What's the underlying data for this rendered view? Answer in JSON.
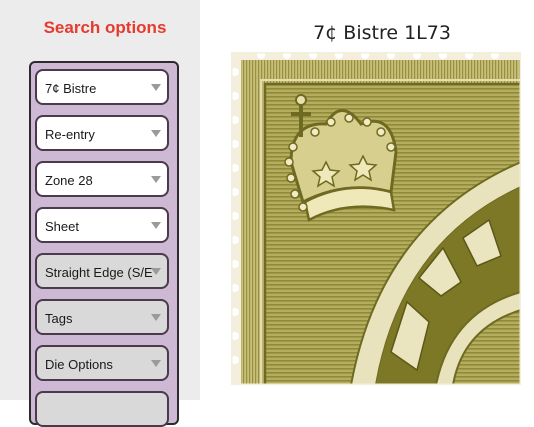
{
  "sidebar": {
    "title": "Search options",
    "dropdowns": [
      {
        "label": "7¢ Bistre"
      },
      {
        "label": "Re-entry"
      },
      {
        "label": "Zone 28"
      },
      {
        "label": "Sheet"
      },
      {
        "label": "Straight Edge (S/E)"
      },
      {
        "label": "Tags"
      },
      {
        "label": "Die Options"
      },
      {
        "label": ""
      }
    ]
  },
  "main": {
    "title": "7¢ Bistre 1L73",
    "image_icon": "stamp-closeup-image"
  },
  "colors": {
    "accent": "#e63b2e",
    "panel": "#cdb9d3",
    "stamp_ink": "#8c8a36",
    "stamp_paper": "#f3efdc"
  }
}
